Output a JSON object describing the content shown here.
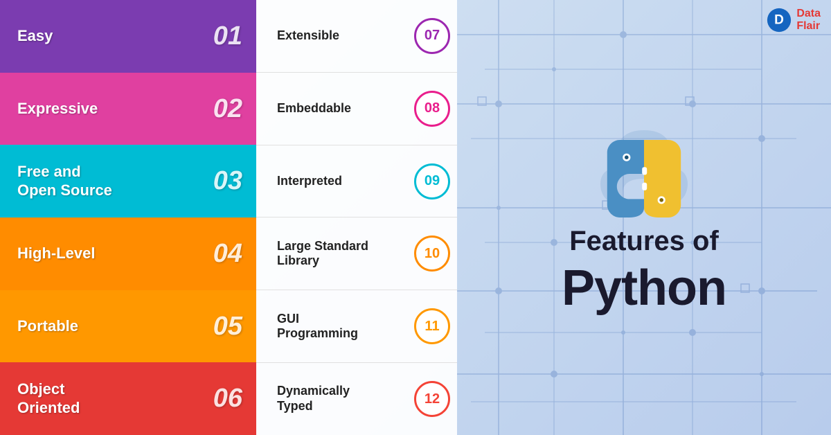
{
  "page": {
    "title": "Features of Python"
  },
  "brand": {
    "name_line1": "Data",
    "name_line2": "Flair"
  },
  "left_features": [
    {
      "id": 1,
      "label": "Easy",
      "number": "01",
      "color_class": "row-1"
    },
    {
      "id": 2,
      "label": "Expressive",
      "number": "02",
      "color_class": "row-2"
    },
    {
      "id": 3,
      "label": "Free and\nOpen Source",
      "number": "03",
      "color_class": "row-3"
    },
    {
      "id": 4,
      "label": "High-Level",
      "number": "04",
      "color_class": "row-4"
    },
    {
      "id": 5,
      "label": "Portable",
      "number": "05",
      "color_class": "row-5"
    },
    {
      "id": 6,
      "label": "Object\nOriented",
      "number": "06",
      "color_class": "row-6"
    }
  ],
  "right_features": [
    {
      "id": 7,
      "label": "Extensible",
      "number": "07",
      "circle_class": "circle-purple"
    },
    {
      "id": 8,
      "label": "Embeddable",
      "number": "08",
      "circle_class": "circle-pink"
    },
    {
      "id": 9,
      "label": "Interpreted",
      "number": "09",
      "circle_class": "circle-cyan"
    },
    {
      "id": 10,
      "label": "Large Standard\nLibrary",
      "number": "10",
      "circle_class": "circle-orange"
    },
    {
      "id": 11,
      "label": "GUI\nProgramming",
      "number": "11",
      "circle_class": "circle-orange2"
    },
    {
      "id": 12,
      "label": "Dynamically\nTyped",
      "number": "12",
      "circle_class": "circle-red"
    }
  ],
  "hero": {
    "features_of": "Features of",
    "python": "Python"
  }
}
